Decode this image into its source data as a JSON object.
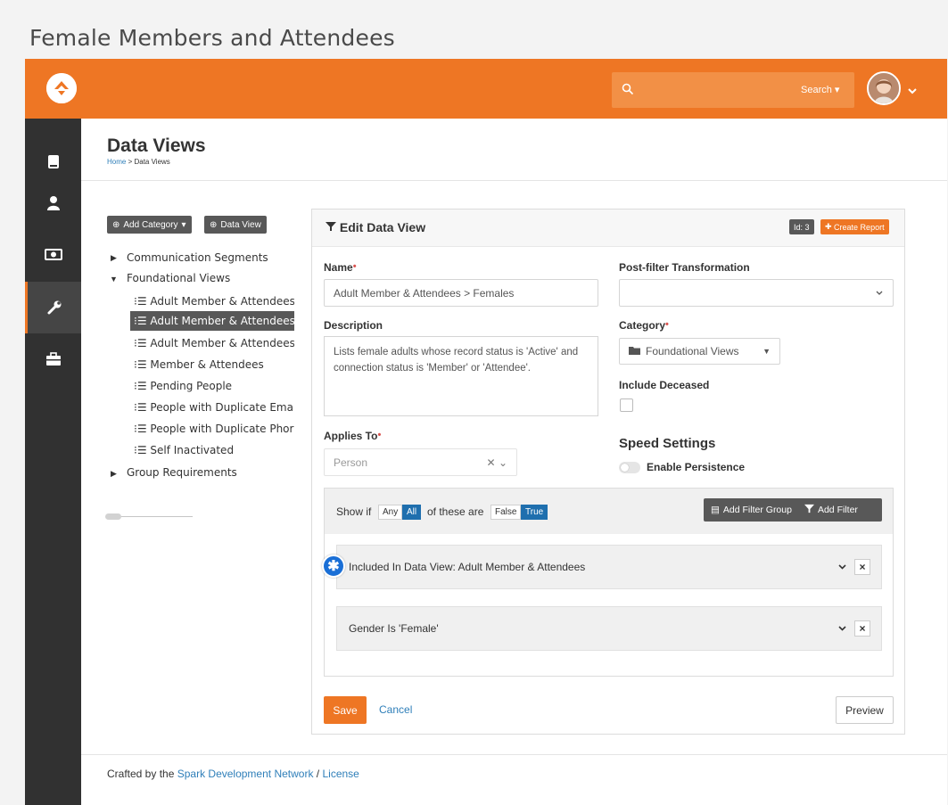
{
  "page_caption": "Female Members and Attendees",
  "topbar": {
    "search_dropdown": "Search",
    "colors": {
      "brand": "#ee7624",
      "sidebar": "#313131"
    }
  },
  "sidebar": {
    "items": [
      {
        "icon": "book-icon"
      },
      {
        "icon": "person-icon"
      },
      {
        "icon": "money-icon"
      },
      {
        "icon": "wrench-icon",
        "active": true
      },
      {
        "icon": "briefcase-icon"
      }
    ]
  },
  "header": {
    "title": "Data Views",
    "breadcrumb_home": "Home",
    "breadcrumb_sep": ">",
    "breadcrumb_current": "Data Views"
  },
  "tree": {
    "add_category": "Add Category",
    "data_view": "Data View",
    "categories": [
      {
        "label": "Communication Segments",
        "expanded": false
      },
      {
        "label": "Foundational Views",
        "expanded": true
      },
      {
        "label": "Group Requirements",
        "expanded": false
      }
    ],
    "leaves": [
      "Adult Member & Attendees",
      "Adult Member & Attendees",
      "Adult Member & Attendees",
      "Member & Attendees",
      "Pending People",
      "People with Duplicate Emai",
      "People with Duplicate Phor",
      "Self Inactivated"
    ],
    "selected_index": 1
  },
  "editor": {
    "title": "Edit Data View",
    "id_badge": "Id: 3",
    "create_report": "Create Report",
    "name_label": "Name",
    "name_value": "Adult Member & Attendees > Females",
    "description_label": "Description",
    "description_value": "Lists female adults whose record status is 'Active' and connection status is 'Member' or 'Attendee'.",
    "applies_label": "Applies To",
    "applies_value": "Person",
    "post_filter_label": "Post-filter Transformation",
    "post_filter_value": "",
    "category_label": "Category",
    "category_value": "Foundational Views",
    "deceased_label": "Include Deceased",
    "speed_title": "Speed Settings",
    "persistence_label": "Enable Persistence",
    "required_mark": "•"
  },
  "filter": {
    "show_if": "Show if",
    "any": "Any",
    "all": "All",
    "of_these_are": "of these are",
    "false_label": "False",
    "true_label": "True",
    "add_group": "Add Filter Group",
    "add_filter": "Add Filter",
    "rules": [
      "Included In Data View: Adult Member & Attendees",
      "Gender Is 'Female'"
    ]
  },
  "actions": {
    "save": "Save",
    "cancel": "Cancel",
    "preview": "Preview"
  },
  "footer": {
    "prefix": "Crafted by the",
    "link1": "Spark Development Network",
    "sep": "/",
    "link2": "License"
  }
}
